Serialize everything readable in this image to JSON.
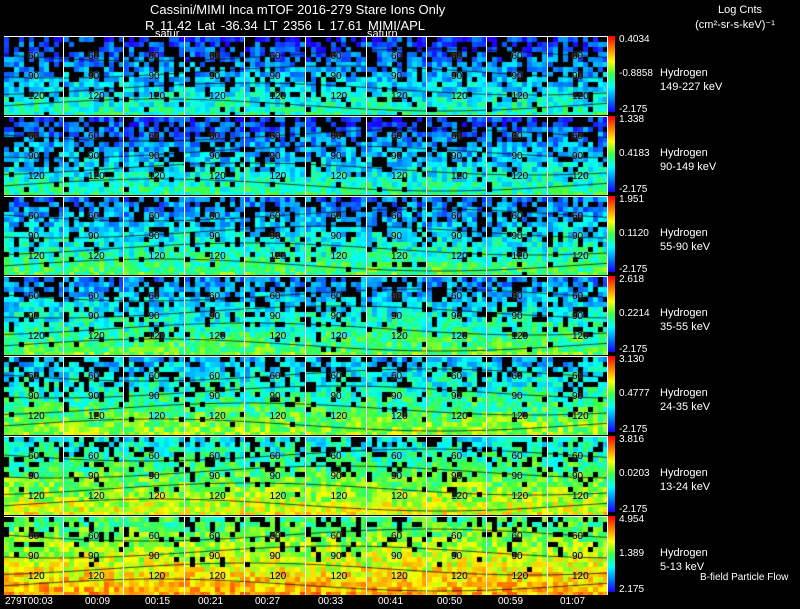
{
  "header": {
    "title": "Cassini/MIMI Inca mTOF  2016-279    Stare    Ions Only",
    "subtitle": "R      11.42 Lat -36.34 LT 2356 L          17.61  MIMI/APL",
    "legend_title": "Log Cnts",
    "legend_units": "(cm²-sr-s-keV)⁻¹"
  },
  "saturn_labels": [
    "satur",
    "saturn"
  ],
  "rows": [
    {
      "species": "Hydrogen",
      "energy": "149-227 keV",
      "max": "0.4034",
      "mid": "-0.8858",
      "min": "-2.175",
      "level": 0.12
    },
    {
      "species": "Hydrogen",
      "energy": "90-149 keV",
      "max": "1.338",
      "mid": "0.4183",
      "min": "-2.175",
      "level": 0.15
    },
    {
      "species": "Hydrogen",
      "energy": "55-90 keV",
      "max": "1.951",
      "mid": "0.1120",
      "min": "-2.175",
      "level": 0.25
    },
    {
      "species": "Hydrogen",
      "energy": "35-55 keV",
      "max": "2.618",
      "mid": "0.2214",
      "min": "-2.175",
      "level": 0.3
    },
    {
      "species": "Hydrogen",
      "energy": "24-35 keV",
      "max": "3.130",
      "mid": "0.4777",
      "min": "-2.175",
      "level": 0.4
    },
    {
      "species": "Hydrogen",
      "energy": "13-24 keV",
      "max": "3.816",
      "mid": "0.0203",
      "min": "-2.175",
      "level": 0.55
    },
    {
      "species": "Hydrogen",
      "energy": "5-13 keV",
      "max": "4.954",
      "mid": "1.389",
      "min": "2.175",
      "level": 0.75
    }
  ],
  "time_ticks": [
    "279T00:03",
    "00:09",
    "00:15",
    "00:21",
    "00:27",
    "00:33",
    "00:41",
    "00:50",
    "00:59",
    "01:07"
  ],
  "axis_numbers": [
    "30",
    "60",
    "90",
    "120",
    "150"
  ],
  "bfield_label": "B-field Particle Flow",
  "colors": {
    "low": "#1f00ff",
    "high": "#ff0000",
    "background": "#000000"
  }
}
